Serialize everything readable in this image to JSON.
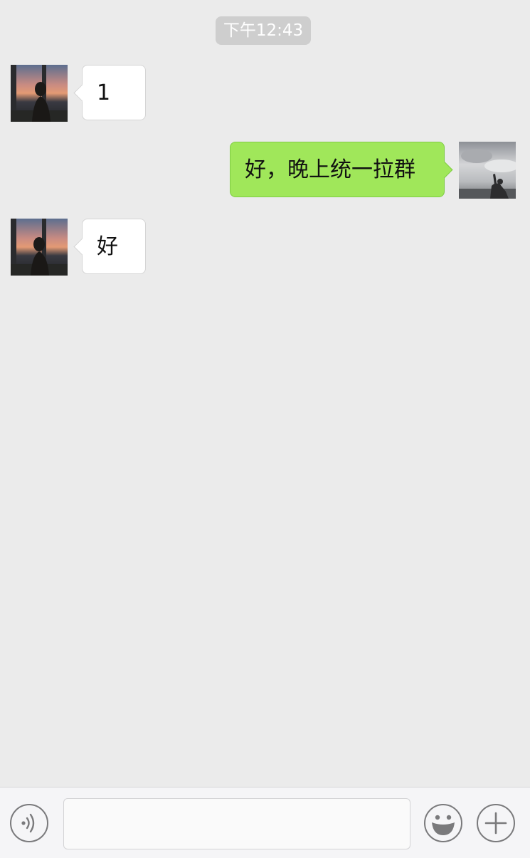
{
  "chat": {
    "timestamp": "下午12:43",
    "messages": [
      {
        "side": "left",
        "text": "1",
        "avatar": "contact-avatar"
      },
      {
        "side": "right",
        "text": "好，晚上统一拉群",
        "avatar": "self-avatar"
      },
      {
        "side": "left",
        "text": "好",
        "avatar": "contact-avatar"
      }
    ]
  },
  "input_bar": {
    "value": "",
    "icons": [
      "voice-icon",
      "emoji-icon",
      "plus-icon"
    ]
  },
  "colors": {
    "background": "#ebebeb",
    "incoming_bubble": "#ffffff",
    "outgoing_bubble": "#a0e75a",
    "timestamp_bg": "#cecece"
  }
}
